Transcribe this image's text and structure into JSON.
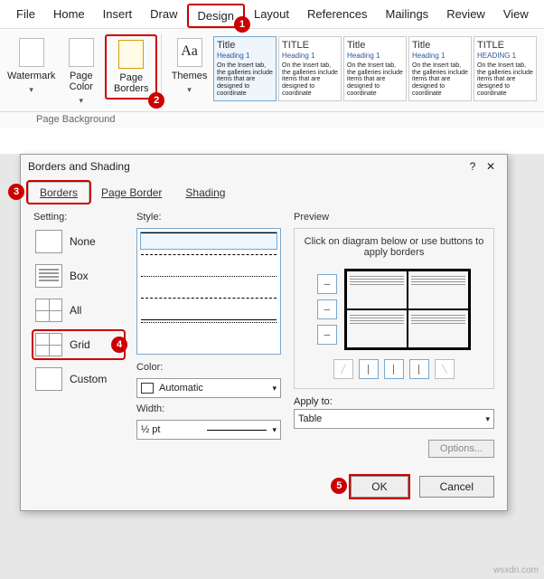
{
  "ribbon": {
    "tabs": [
      "File",
      "Home",
      "Insert",
      "Draw",
      "Design",
      "Layout",
      "References",
      "Mailings",
      "Review",
      "View"
    ],
    "group_label": "Page Background",
    "items": {
      "watermark": "Watermark",
      "pagecolor": "Page Color",
      "pageborders": "Page Borders",
      "themes": "Themes"
    },
    "theme_tiles": [
      {
        "title": "Title",
        "heading": "Heading 1"
      },
      {
        "title": "TITLE",
        "heading": "Heading 1"
      },
      {
        "title": "Title",
        "heading": "Heading 1"
      },
      {
        "title": "Title",
        "heading": "Heading 1"
      },
      {
        "title": "TITLE",
        "heading": "HEADING 1"
      }
    ]
  },
  "dialog": {
    "title": "Borders and Shading",
    "tabs": {
      "borders": "Borders",
      "pageborder": "Page Border",
      "shading": "Shading"
    },
    "setting": {
      "label": "Setting:",
      "none": "None",
      "box": "Box",
      "all": "All",
      "grid": "Grid",
      "custom": "Custom"
    },
    "style": {
      "label": "Style:"
    },
    "color": {
      "label": "Color:",
      "value": "Automatic"
    },
    "width": {
      "label": "Width:",
      "value": "½ pt"
    },
    "preview": {
      "label": "Preview",
      "hint": "Click on diagram below or use buttons to apply borders"
    },
    "applyto": {
      "label": "Apply to:",
      "value": "Table"
    },
    "options": "Options...",
    "ok": "OK",
    "cancel": "Cancel"
  },
  "watermark": "wsxdn.com",
  "badges": {
    "b1": "1",
    "b2": "2",
    "b3": "3",
    "b4": "4",
    "b5": "5"
  }
}
